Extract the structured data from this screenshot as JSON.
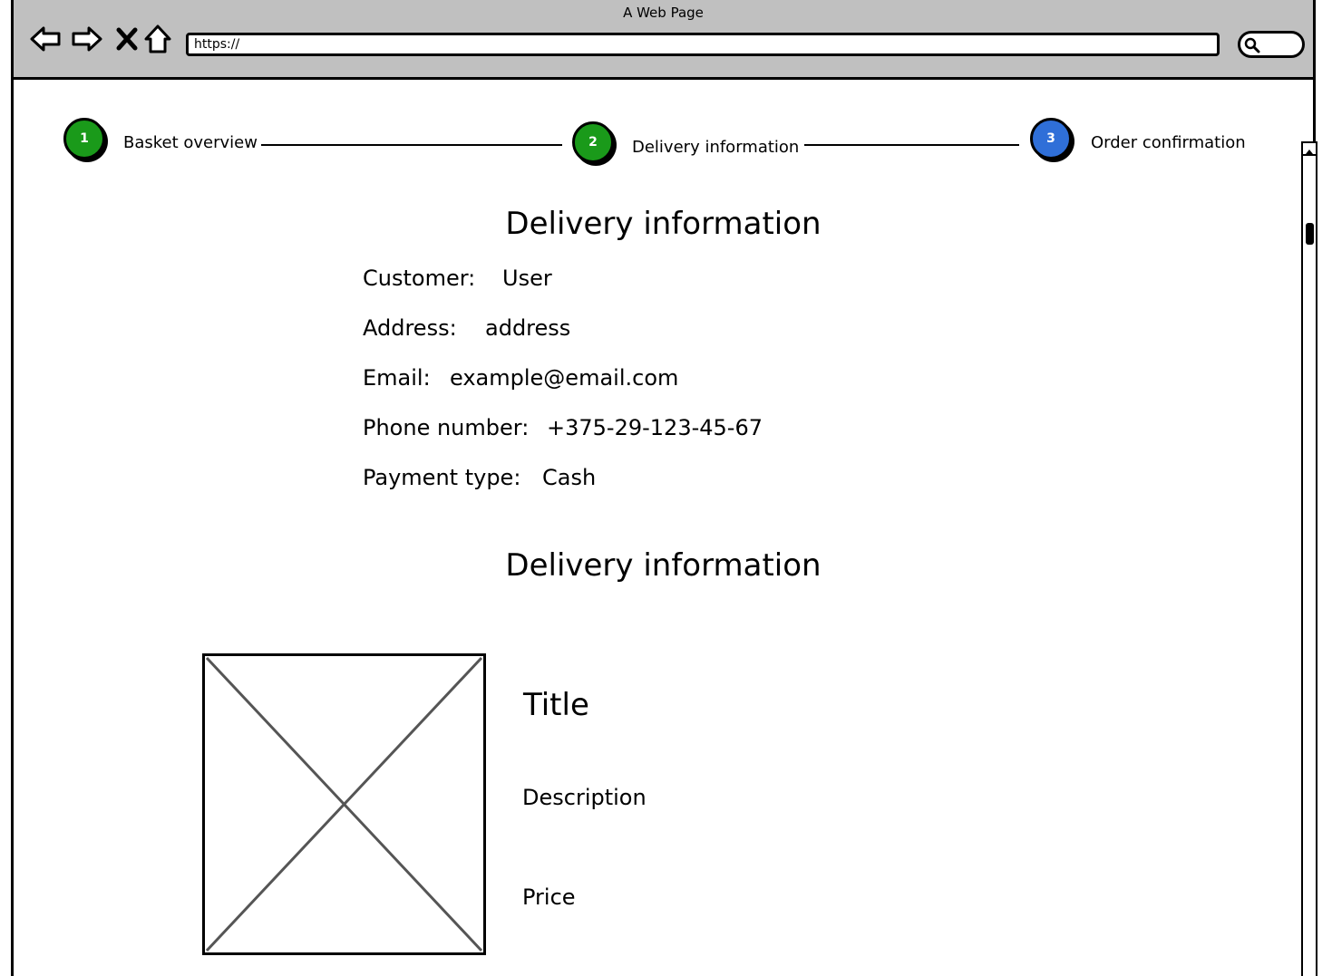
{
  "browser": {
    "title": "A Web Page",
    "url": "https://"
  },
  "steps": [
    {
      "number": "1",
      "label": "Basket overview",
      "color": "#1a9a1a"
    },
    {
      "number": "2",
      "label": "Delivery information",
      "color": "#1a9a1a"
    },
    {
      "number": "3",
      "label": "Order confirmation",
      "color": "#2f6fd8"
    }
  ],
  "delivery": {
    "heading": "Delivery information",
    "fields": [
      {
        "key": "Customer:",
        "value": "User"
      },
      {
        "key": "Address:",
        "value": "address"
      },
      {
        "key": "Email:",
        "value": "example@email.com"
      },
      {
        "key": "Phone number:",
        "value": "+375-29-123-45-67"
      },
      {
        "key": "Payment type:",
        "value": "Cash"
      }
    ]
  },
  "products_section": {
    "heading": "Delivery information",
    "item": {
      "title": "Title",
      "description": "Description",
      "price": "Price"
    }
  }
}
